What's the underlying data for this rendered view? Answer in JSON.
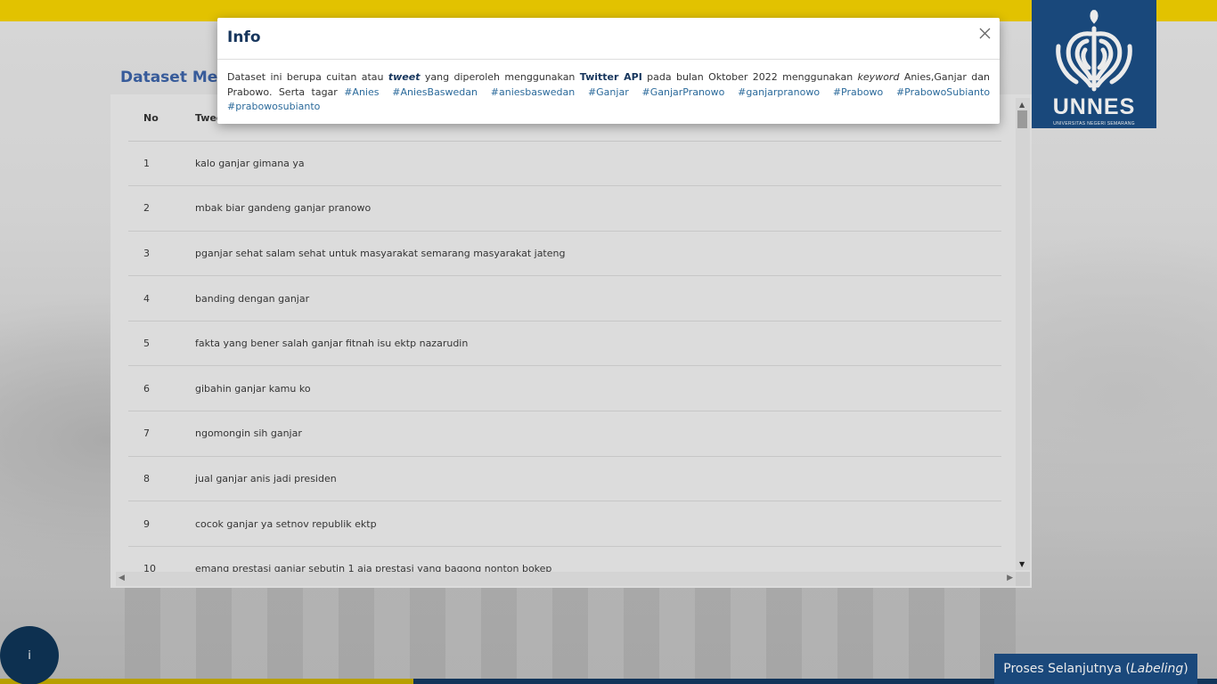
{
  "header": {
    "logo_text": "UNNES",
    "logo_subtext": "UNIVERSITAS NEGERI SEMARANG"
  },
  "page": {
    "heading": "Dataset Ment"
  },
  "table": {
    "columns": [
      "No",
      "Twee"
    ],
    "rows": [
      {
        "no": "1",
        "tweet": "kalo ganjar gimana ya"
      },
      {
        "no": "2",
        "tweet": "mbak biar gandeng ganjar pranowo"
      },
      {
        "no": "3",
        "tweet": "pganjar sehat salam sehat untuk masyarakat semarang masyarakat jateng"
      },
      {
        "no": "4",
        "tweet": "banding dengan ganjar"
      },
      {
        "no": "5",
        "tweet": "fakta yang bener salah ganjar fitnah isu ektp nazarudin"
      },
      {
        "no": "6",
        "tweet": "gibahin ganjar kamu ko"
      },
      {
        "no": "7",
        "tweet": "ngomongin sih ganjar"
      },
      {
        "no": "8",
        "tweet": "jual ganjar anis jadi presiden"
      },
      {
        "no": "9",
        "tweet": "cocok ganjar ya setnov republik ektp"
      },
      {
        "no": "10",
        "tweet": "emang prestasi ganjar sebutin 1 aja prestasi yang bagong nonton bokep"
      }
    ]
  },
  "modal": {
    "title": "Info",
    "body": {
      "t1": "Dataset ini berupa cuitan atau ",
      "tweet_word": "tweet",
      "t2": " yang diperoleh menggunakan ",
      "api": "Twitter API",
      "t3": " pada bulan Oktober 2022 menggunakan ",
      "keyword_word": "keyword",
      "t4": " Anies,Ganjar dan Prabowo. Serta tagar ",
      "hashtags": [
        "#Anies",
        "#AniesBaswedan",
        "#aniesbaswedan",
        "#Ganjar",
        "#GanjarPranowo",
        "#ganjarpranowo",
        "#Prabowo",
        "#PrabowoSubianto",
        "#prabowosubianto"
      ]
    }
  },
  "fab": {
    "label": "i"
  },
  "next_button": {
    "label": "Proses Selanjutnya (",
    "italic": "Labeling",
    "close": ")"
  },
  "colors": {
    "brand_yellow": "#f6d300",
    "brand_blue": "#1d4f86",
    "title_navy": "#17365d",
    "link_blue": "#2b6a9b"
  },
  "icons": {
    "close": "close-icon",
    "logo": "unnes-emblem-icon"
  }
}
